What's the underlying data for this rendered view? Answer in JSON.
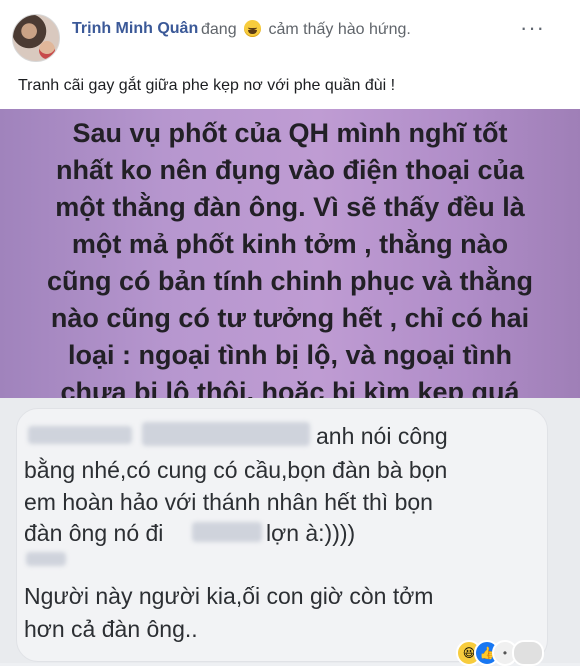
{
  "post": {
    "author": "Trịnh Minh Quân",
    "status_prefix": "đang",
    "status_suffix": "cảm thấy hào hứng.",
    "emoji_icon": "grinning-face-icon",
    "more_icon": "more-options-icon",
    "caption": "Tranh cãi gay gắt giữa phe kẹp nơ với phe quần đùi !",
    "banner_lines": [
      "Sau vụ phốt của QH mình nghĩ tốt",
      "nhất ko nên đụng vào điện thoại của",
      "một thằng đàn ông. Vì sẽ thấy đều là",
      "một mả phốt kinh tởm , thằng nào",
      "cũng có bản tính chinh phục và thằng",
      "nào cũng có tư tưởng hết , chỉ có hai",
      "loại : ngoại tình bị lộ, và ngoại tình",
      "chưa bị lộ thôi, hoặc bị kìm kẹp quá"
    ],
    "banner_colors": {
      "start": "#a083bc",
      "end": "#9f7fb7"
    }
  },
  "comments": {
    "c1_line1": "anh nói công",
    "c1_line2": "bằng nhé,có cung có cầu,bọn đàn bà bọn",
    "c1_line3": "em hoàn hảo với thánh nhân hết thì bọn",
    "c1_line4a": "đàn ông nó đi",
    "c1_line4b": "lợn à:))))",
    "c2_line1": "Người này người kia,ối con giờ còn tởm",
    "c2_line2": "hơn cả đàn ông.."
  },
  "reactions": [
    "haha-icon",
    "like-icon",
    "other-icon"
  ]
}
